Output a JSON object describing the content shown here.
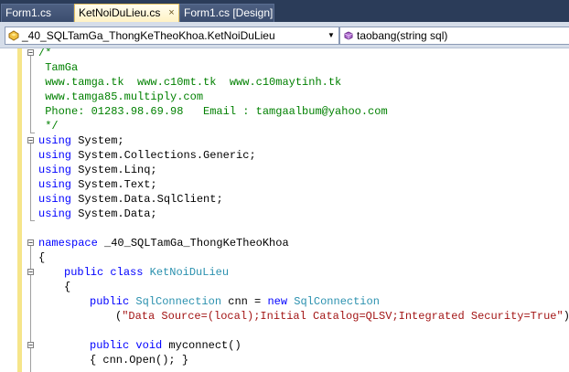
{
  "tabs": [
    {
      "label": "Form1.cs",
      "active": false
    },
    {
      "label": "KetNoiDuLieu.cs",
      "active": true,
      "close": "×"
    },
    {
      "label": "Form1.cs [Design]",
      "active": false
    }
  ],
  "navbar": {
    "type_combo": {
      "value": "_40_SQLTamGa_ThongKeTheoKhoa.KetNoiDuLieu",
      "icon": "class-icon"
    },
    "member_combo": {
      "value": "taobang(string sql)",
      "icon": "method-icon"
    }
  },
  "code": {
    "c1": "/*",
    "c2": " TamGa",
    "c3": " www.tamga.tk  www.c10mt.tk  www.c10maytinh.tk",
    "c4": " www.tamga85.multiply.com",
    "c5": " Phone: 01283.98.69.98   Email : tamgaalbum@yahoo.com",
    "c6": " */",
    "u1": "System;",
    "u2": "System.Collections.Generic;",
    "u3": "System.Linq;",
    "u4": "System.Text;",
    "u5": "System.Data.SqlClient;",
    "u6": "System.Data;",
    "ns_name": " _40_SQLTamGa_ThongKeTheoKhoa",
    "class_name": "KetNoiDuLieu",
    "field_type": "SqlConnection",
    "field_rest": " cnn = ",
    "ctor_type": "SqlConnection",
    "conn_string": "\"Data Source=(local);Initial Catalog=QLSV;Integrated Security=True\"",
    "method_name": " myconnect()",
    "method_body": "{ cnn.Open(); }",
    "kw_using": "using",
    "kw_namespace": "namespace",
    "kw_public": "public",
    "kw_class": "class",
    "kw_new": "new",
    "kw_void": "void",
    "open_brace": "{",
    "paren_open": "(",
    "paren_close": ");"
  },
  "colors": {
    "keyword": "#0000ff",
    "type": "#2b91af",
    "comment": "#008000",
    "string": "#a31515"
  }
}
